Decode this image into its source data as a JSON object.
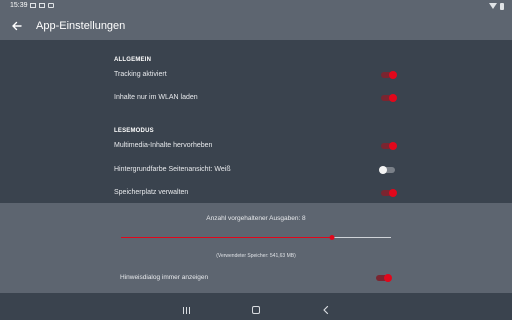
{
  "status_bar": {
    "time": "15:39",
    "left_icons": [
      "gallery-icon",
      "image-icon",
      "download-icon"
    ],
    "right_icons": [
      "wifi-icon",
      "battery-icon"
    ]
  },
  "app_bar": {
    "title": "App-Einstellungen",
    "back_icon": "arrow-left-icon",
    "background": "#5d6570"
  },
  "sections": {
    "general": {
      "header": "ALLGEMEIN",
      "items": [
        {
          "label": "Tracking aktiviert",
          "enabled": true
        },
        {
          "label": "Inhalte nur im WLAN laden",
          "enabled": true
        }
      ]
    },
    "reading": {
      "header": "LESEMODUS",
      "items": [
        {
          "label": "Multimedia-Inhalte hervorheben",
          "enabled": true
        },
        {
          "label": "Hintergrundfarbe Seitenansicht: Weiß",
          "enabled": false
        },
        {
          "label": "Speicherplatz verwalten",
          "enabled": true
        }
      ]
    }
  },
  "storage": {
    "slider_label": "Anzahl vorgehaltener Ausgaben: 8",
    "slider_value_fraction": 0.78,
    "used_storage": "(Verwendeter Speicher: 541,63 MB)",
    "hint_label": "Hinweisdialog immer anzeigen",
    "hint_enabled": true
  },
  "nav_bar": {
    "icons": [
      "recents-icon",
      "home-icon",
      "back-icon"
    ]
  },
  "colors": {
    "accent": "#e1071b",
    "background": "#3a434e",
    "panel": "#5d6570"
  }
}
